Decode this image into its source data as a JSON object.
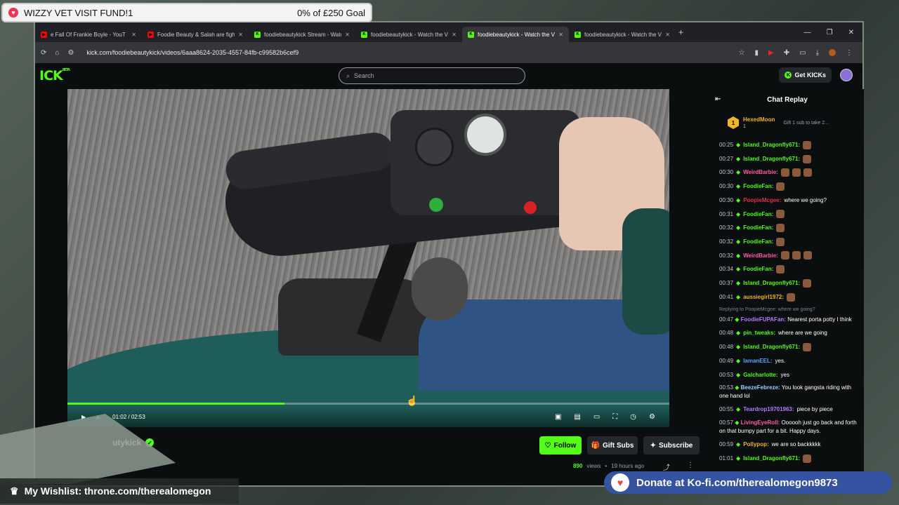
{
  "overlay": {
    "goal_title": "WIZZY VET VISIT FUND!1",
    "goal_progress": "0% of £250 Goal",
    "wishlist": "My Wishlist: throne.com/therealomegon",
    "kofi": "Donate at Ko-fi.com/therealomegon9873"
  },
  "browser": {
    "tabs": [
      {
        "title": "e Fall Of Frankie Boyle - YouT",
        "icon": "youtube",
        "active": false
      },
      {
        "title": "Foodie Beauty & Salah are fight",
        "icon": "youtube",
        "active": false
      },
      {
        "title": "foodiebeautykick Stream - Watc",
        "icon": "kick",
        "active": false
      },
      {
        "title": "foodiebeautykick - Watch the V",
        "icon": "kick",
        "active": false
      },
      {
        "title": "foodiebeautykick - Watch the V",
        "icon": "kick",
        "active": true
      },
      {
        "title": "foodiebeautykick - Watch the V",
        "icon": "kick",
        "active": false
      }
    ],
    "url": "kick.com/foodiebeautykick/videos/6aaa8624-2035-4557-84fb-c99582b6cef9"
  },
  "header": {
    "logo": "ICK",
    "logo_sup": "BETA",
    "search_placeholder": "Search",
    "get_kicks": "Get KICKs"
  },
  "video": {
    "time": "01:02 / 02:53",
    "progress": 0.36
  },
  "channel": {
    "name": "utykick",
    "follow": "Follow",
    "gift_subs": "Gift Subs",
    "subscribe": "Subscribe",
    "views_count": "890",
    "views_label": "views",
    "age": "19 hours ago"
  },
  "chat": {
    "title": "Chat Replay",
    "pinned": {
      "badge": "1",
      "user": "HexedMoon",
      "count": "1",
      "cta": "Gift 1 sub to take 2..."
    },
    "messages": [
      {
        "ts": "00:25",
        "user": "Island_Dragonfly671:",
        "color": "#53fc18",
        "text": "",
        "emotes": 1
      },
      {
        "ts": "00:27",
        "user": "Island_Dragonfly671:",
        "color": "#53fc18",
        "text": "",
        "emotes": 1
      },
      {
        "ts": "00:30",
        "user": "WeirdBarbie:",
        "color": "#ff5ca8",
        "text": "",
        "emotes": 3
      },
      {
        "ts": "00:30",
        "user": "FoodieFan:",
        "color": "#53fc18",
        "text": "",
        "emotes": 1
      },
      {
        "ts": "00:30",
        "user": "PoopieMcgee:",
        "color": "#e0304a",
        "text": "where we going?",
        "emotes": 0
      },
      {
        "ts": "00:31",
        "user": "FoodieFan:",
        "color": "#53fc18",
        "text": "",
        "emotes": 1
      },
      {
        "ts": "00:32",
        "user": "FoodieFan:",
        "color": "#53fc18",
        "text": "",
        "emotes": 1
      },
      {
        "ts": "00:32",
        "user": "FoodieFan:",
        "color": "#53fc18",
        "text": "",
        "emotes": 1
      },
      {
        "ts": "00:32",
        "user": "WeirdBarbie:",
        "color": "#ff5ca8",
        "text": "",
        "emotes": 3
      },
      {
        "ts": "00:34",
        "user": "FoodieFan:",
        "color": "#53fc18",
        "text": "",
        "emotes": 1
      },
      {
        "ts": "00:37",
        "user": "Island_Dragonfly671:",
        "color": "#53fc18",
        "text": "",
        "emotes": 1
      },
      {
        "ts": "00:41",
        "user": "aussiegirl1972:",
        "color": "#f0b429",
        "text": "",
        "emotes": 1
      }
    ],
    "reply_note": "Replying to PoopieMcgee: where we going?",
    "messages2": [
      {
        "ts": "00:47",
        "user": "FoodieFUPAFan:",
        "color": "#b57cff",
        "text": "Nearest porta potty I think",
        "wrap": true
      },
      {
        "ts": "00:48",
        "user": "pin_tweaks:",
        "color": "#53fc18",
        "text": "where are we going"
      },
      {
        "ts": "00:48",
        "user": "Island_Dragonfly671:",
        "color": "#53fc18",
        "text": ""
      },
      {
        "ts": "00:49",
        "user": "lamanEEL:",
        "color": "#5aa0ff",
        "text": "yes."
      },
      {
        "ts": "00:53",
        "user": "Galcharlotte:",
        "color": "#53fc18",
        "text": "yes"
      },
      {
        "ts": "00:53",
        "user": "BeezeFebreze:",
        "color": "#9ad0ff",
        "text": "You look gangsta riding with one hand lol",
        "wrap": true
      },
      {
        "ts": "00:55",
        "user": "Teardrop19701963:",
        "color": "#b57cff",
        "text": "piece by piece"
      },
      {
        "ts": "00:57",
        "user": "LivingEyeRoll:",
        "color": "#ff5ca8",
        "text": "Oooooh just go back and forth on that bumpy part for a bit. Happy days.",
        "wrap": true
      },
      {
        "ts": "00:59",
        "user": "Pollypop:",
        "color": "#f0b429",
        "text": "we are so backkkkk"
      },
      {
        "ts": "01:01",
        "user": "Island_Dragonfly671:",
        "color": "#53fc18",
        "text": ""
      }
    ]
  },
  "colors": {
    "brand": "#53fc18",
    "background": "#0b0e0f"
  }
}
